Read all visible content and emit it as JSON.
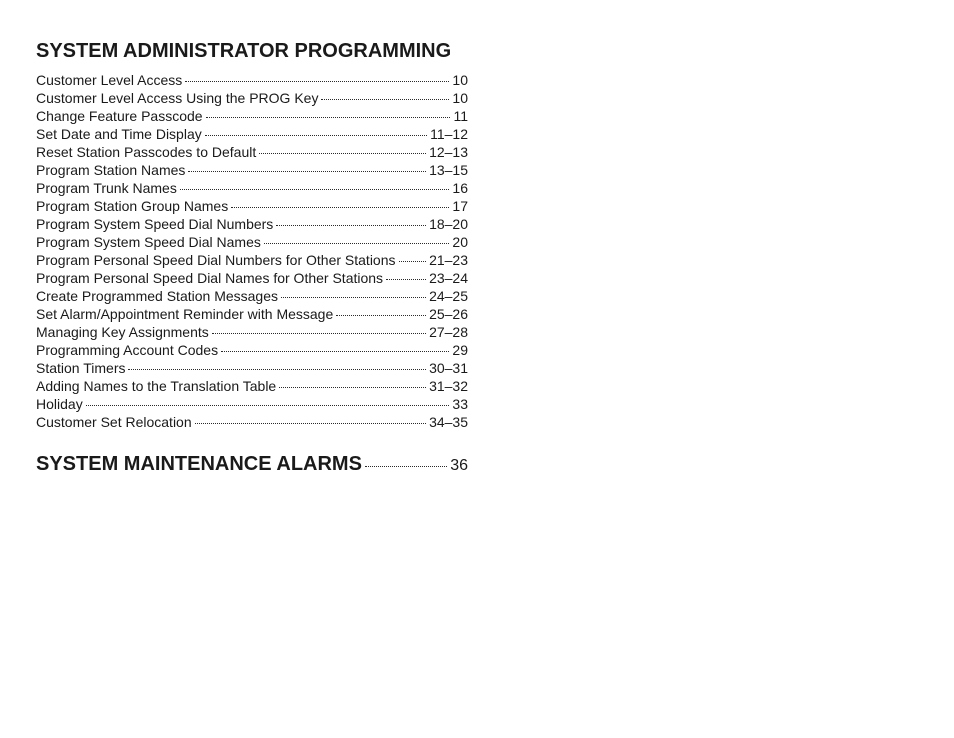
{
  "sections": [
    {
      "heading": "SYSTEM ADMINISTRATOR PROGRAMMING",
      "heading_page": "",
      "entries": [
        {
          "title": "Customer Level Access",
          "page": "10"
        },
        {
          "title": "Customer Level Access Using the PROG Key",
          "page": "10"
        },
        {
          "title": "Change Feature Passcode",
          "page": "11"
        },
        {
          "title": "Set Date and Time Display",
          "page": "11–12"
        },
        {
          "title": "Reset Station Passcodes to Default",
          "page": "12–13"
        },
        {
          "title": "Program Station Names",
          "page": "13–15"
        },
        {
          "title": "Program Trunk Names",
          "page": "16"
        },
        {
          "title": "Program Station Group Names",
          "page": "17"
        },
        {
          "title": "Program System Speed Dial Numbers",
          "page": "18–20"
        },
        {
          "title": "Program System Speed Dial Names",
          "page": "20"
        },
        {
          "title": "Program Personal Speed Dial Numbers for Other Stations",
          "page": "21–23"
        },
        {
          "title": "Program Personal Speed Dial Names for Other Stations",
          "page": "23–24"
        },
        {
          "title": "Create Programmed Station Messages",
          "page": "24–25"
        },
        {
          "title": "Set Alarm/Appointment Reminder with Message",
          "page": "25–26"
        },
        {
          "title": "Managing Key Assignments",
          "page": "27–28"
        },
        {
          "title": "Programming Account Codes",
          "page": "29"
        },
        {
          "title": "Station Timers",
          "page": "30–31"
        },
        {
          "title": "Adding Names to the Translation Table",
          "page": "31–32"
        },
        {
          "title": "Holiday",
          "page": "33"
        },
        {
          "title": "Customer Set Relocation",
          "page": "34–35"
        }
      ]
    },
    {
      "heading": "SYSTEM MAINTENANCE ALARMS",
      "heading_page": "36",
      "entries": []
    }
  ]
}
